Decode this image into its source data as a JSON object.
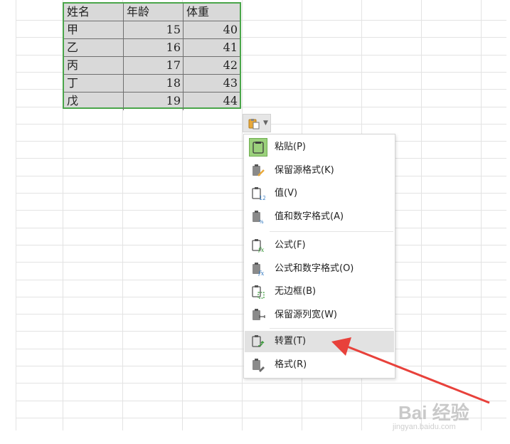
{
  "sheet": {
    "table": {
      "headers": [
        "姓名",
        "年龄",
        "体重"
      ],
      "rows": [
        [
          "甲",
          "15",
          "40"
        ],
        [
          "乙",
          "16",
          "41"
        ],
        [
          "丙",
          "17",
          "42"
        ],
        [
          "丁",
          "18",
          "43"
        ],
        [
          "戊",
          "19",
          "44"
        ]
      ]
    }
  },
  "paste_menu": {
    "items": [
      {
        "label": "粘贴(P)",
        "icon": "paste-icon"
      },
      {
        "label": "保留源格式(K)",
        "icon": "keep-source-format-icon"
      },
      {
        "label": "值(V)",
        "icon": "values-icon"
      },
      {
        "label": "值和数字格式(A)",
        "icon": "values-number-format-icon"
      },
      {
        "label": "公式(F)",
        "icon": "formulas-icon"
      },
      {
        "label": "公式和数字格式(O)",
        "icon": "formulas-number-format-icon"
      },
      {
        "label": "无边框(B)",
        "icon": "no-borders-icon"
      },
      {
        "label": "保留源列宽(W)",
        "icon": "keep-column-width-icon"
      },
      {
        "label": "转置(T)",
        "icon": "transpose-icon"
      },
      {
        "label": "格式(R)",
        "icon": "formatting-icon"
      }
    ]
  },
  "watermark": {
    "main": "Bai  经验",
    "sub": "jingyan.baidu.com"
  },
  "colors": {
    "selection_border": "#4aa54a",
    "selected_fill": "#d9d9d9",
    "menu_highlight": "#e2e2e2",
    "arrow": "#e8413b"
  }
}
